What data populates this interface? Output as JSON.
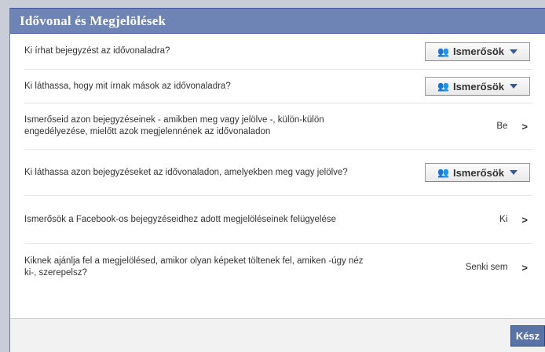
{
  "dialog": {
    "title": "Idővonal és Megjelölések",
    "rows": [
      {
        "label": "Ki írhat bejegyzést az idővonaladra?",
        "control": "dropdown",
        "value": "Ismerősök"
      },
      {
        "label": "Ki láthassa, hogy mit írnak mások az idővonaladra?",
        "control": "dropdown",
        "value": "Ismerősök"
      },
      {
        "label": "Ismerőseid azon bejegyzéseinek - amikben meg vagy jelölve -, külön-külön engedélyezése, mielőtt azok megjelennének az idővonaladon",
        "control": "link",
        "value": "Be"
      },
      {
        "label": "Ki láthassa azon bejegyzéseket az idővonaladon, amelyekben meg vagy jelölve?",
        "control": "dropdown",
        "value": "Ismerősök"
      },
      {
        "label": "Ismerősök a Facebook-os bejegyzéseidhez adott megjelöléseinek felügyelése",
        "control": "link",
        "value": "Ki"
      },
      {
        "label": "Kiknek ajánlja fel a megjelölésed, amikor olyan képeket töltenek fel, amiken -úgy néz ki-, szerepelsz?",
        "control": "link",
        "value": "Senki sem"
      }
    ],
    "done_label": "Kész"
  },
  "colors": {
    "header": "#6d84b4",
    "accent": "#3b5998",
    "button": "#5b74a8"
  },
  "icons": {
    "dropdown_icon": "people-icon",
    "caret": "caret-down-icon",
    "chevron": "chevron-right-icon"
  }
}
